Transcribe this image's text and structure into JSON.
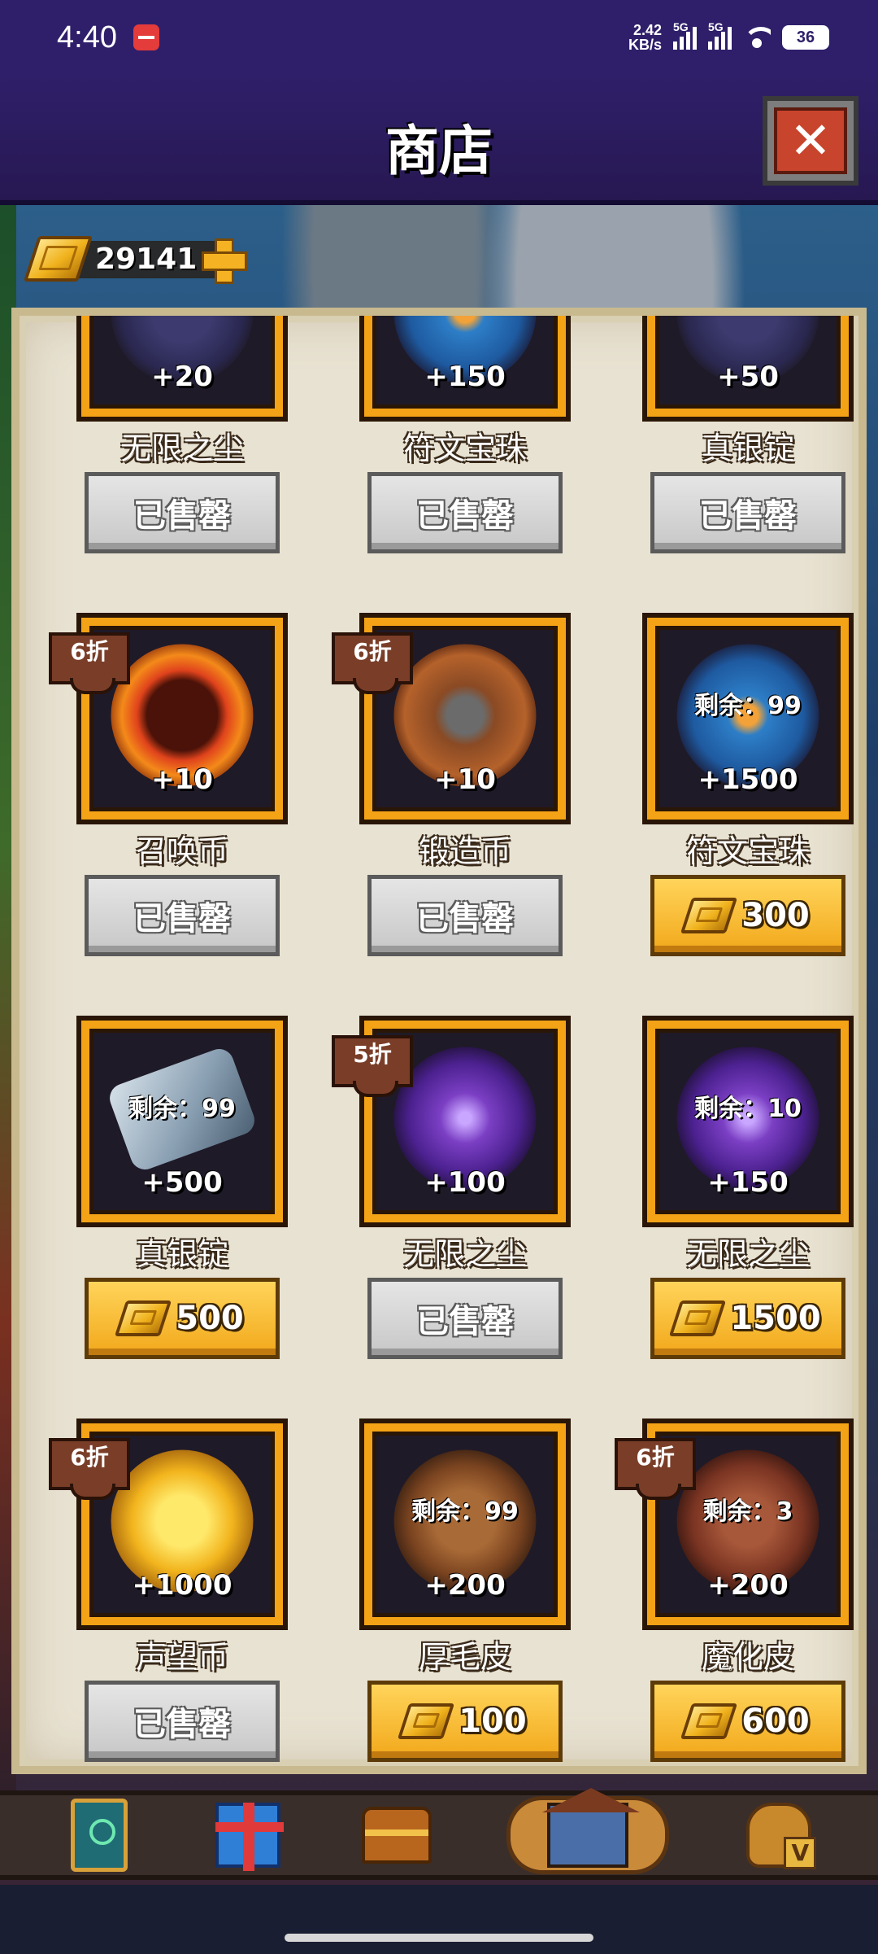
{
  "status_bar": {
    "time": "4:40",
    "net_speed_value": "2.42",
    "net_speed_unit": "KB/s",
    "signal1_label": "5G",
    "signal2_label": "5G",
    "battery": "36"
  },
  "header": {
    "title": "商店"
  },
  "currency": {
    "gold": "29141"
  },
  "items": [
    {
      "name": "无限之尘",
      "qty": "+20",
      "remaining": "",
      "discount": "",
      "price": "",
      "sold_label": "已售罄"
    },
    {
      "name": "符文宝珠",
      "qty": "+150",
      "remaining": "",
      "discount": "",
      "price": "",
      "sold_label": "已售罄"
    },
    {
      "name": "真银锭",
      "qty": "+50",
      "remaining": "",
      "discount": "",
      "price": "",
      "sold_label": "已售罄"
    },
    {
      "name": "召唤币",
      "qty": "+10",
      "remaining": "",
      "discount": "6折",
      "price": "",
      "sold_label": "已售罄"
    },
    {
      "name": "锻造币",
      "qty": "+10",
      "remaining": "",
      "discount": "6折",
      "price": "",
      "sold_label": "已售罄"
    },
    {
      "name": "符文宝珠",
      "qty": "+1500",
      "remaining": "剩余：99",
      "discount": "",
      "price": "300",
      "sold_label": ""
    },
    {
      "name": "真银锭",
      "qty": "+500",
      "remaining": "剩余：99",
      "discount": "",
      "price": "500",
      "sold_label": ""
    },
    {
      "name": "无限之尘",
      "qty": "+100",
      "remaining": "",
      "discount": "5折",
      "price": "",
      "sold_label": "已售罄"
    },
    {
      "name": "无限之尘",
      "qty": "+150",
      "remaining": "剩余：10",
      "discount": "",
      "price": "1500",
      "sold_label": ""
    },
    {
      "name": "声望币",
      "qty": "+1000",
      "remaining": "",
      "discount": "6折",
      "price": "",
      "sold_label": "已售罄"
    },
    {
      "name": "厚毛皮",
      "qty": "+200",
      "remaining": "剩余：99",
      "discount": "",
      "price": "100",
      "sold_label": ""
    },
    {
      "name": "魔化皮",
      "qty": "+200",
      "remaining": "剩余：3",
      "discount": "6折",
      "price": "600",
      "sold_label": ""
    }
  ],
  "bottom_nav": {
    "bag_letter": "V"
  }
}
